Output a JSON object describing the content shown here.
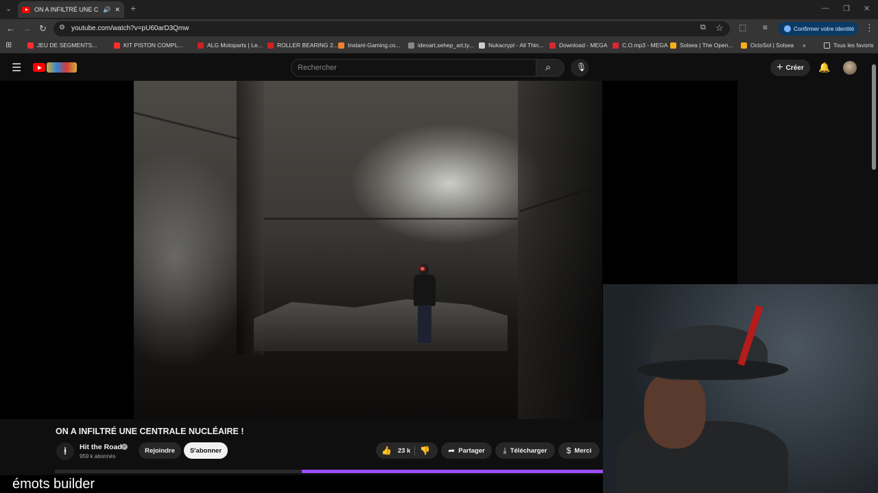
{
  "browser": {
    "tab": {
      "title": "ON A INFILTRÉ UNE CENTR",
      "favicon": "youtube-icon",
      "audio_icon": "speaker-icon"
    },
    "url": "youtube.com/watch?v=pU60arD3Qmw",
    "confirm_identity": "Confirmer votre identité",
    "bookmarks": [
      {
        "label": "JEU DE SEGMENTS...",
        "color": "#ff2d2d"
      },
      {
        "label": "KIT PISTON COMPL...",
        "color": "#ff2d2d"
      },
      {
        "label": "ALG Motoparts | Le...",
        "color": "#d02020"
      },
      {
        "label": "ROLLER BEARING 2...",
        "color": "#d02020"
      },
      {
        "label": "Instant-Gaming.co...",
        "color": "#f08030"
      },
      {
        "label": "ideoart,sehep_art,ty...",
        "color": "#888888"
      },
      {
        "label": "Nukacrypt - All Thin...",
        "color": "#cccccc"
      },
      {
        "label": "Download - MEGA",
        "color": "#d9272e"
      },
      {
        "label": "C.O.mp3 - MEGA",
        "color": "#d9272e"
      },
      {
        "label": "Solsea | The Open...",
        "color": "#f5b01a"
      },
      {
        "label": "OctoSol | Solsea",
        "color": "#f5b01a"
      }
    ],
    "all_bookmarks": "Tous les favoris"
  },
  "youtube": {
    "search_placeholder": "Rechercher",
    "create_label": "Créer"
  },
  "video": {
    "title": "ON A INFILTRÉ UNE CENTRALE NUCLÉAIRE !",
    "channel": "Hit the Road",
    "subscribers": "959 k abonnés",
    "join_label": "Rejoindre",
    "subscribe_label": "S'abonner",
    "likes": "23 k",
    "share_label": "Partager",
    "download_label": "Télécharger",
    "thanks_label": "Merci",
    "progress_fraction": 0.55
  },
  "overlay": {
    "text": "émots builder"
  },
  "colors": {
    "accent_progress": "#9b4dff",
    "youtube_red": "#ff0000"
  }
}
